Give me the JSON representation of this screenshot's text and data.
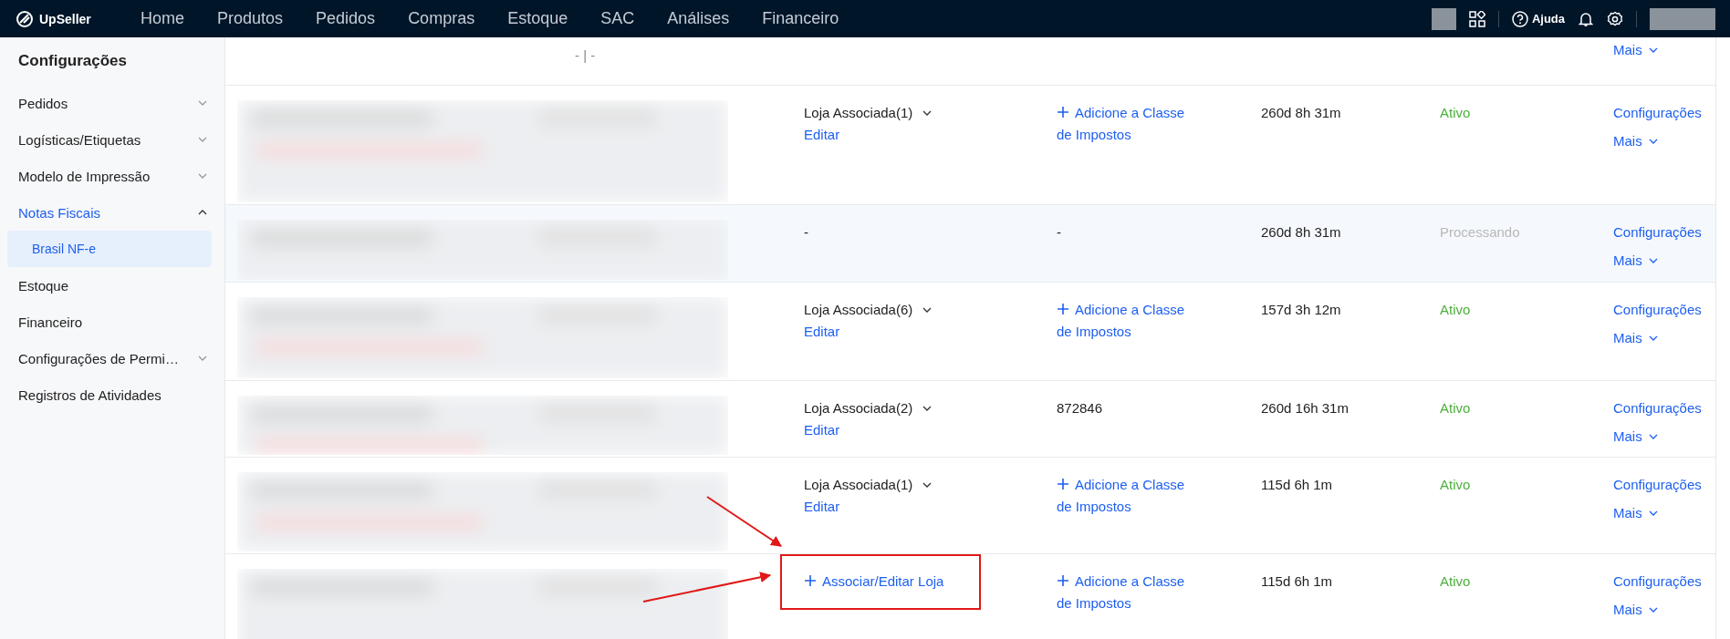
{
  "nav": {
    "brand": "UpSeller",
    "items": [
      {
        "label": "Home"
      },
      {
        "label": "Produtos"
      },
      {
        "label": "Pedidos"
      },
      {
        "label": "Compras"
      },
      {
        "label": "Estoque"
      },
      {
        "label": "SAC"
      },
      {
        "label": "Análises"
      },
      {
        "label": "Financeiro"
      }
    ],
    "help": "Ajuda"
  },
  "sidebar": {
    "title": "Configurações",
    "items": [
      {
        "label": "Pedidos",
        "expanded": false,
        "selected": false
      },
      {
        "label": "Logísticas/Etiquetas",
        "expanded": false,
        "selected": false
      },
      {
        "label": "Modelo de Impressão",
        "expanded": false,
        "selected": false
      },
      {
        "label": "Notas Fiscais",
        "expanded": true,
        "selected": true,
        "children": [
          {
            "label": "Brasil NF-e",
            "selected": true
          }
        ]
      },
      {
        "label": "Estoque",
        "selected": false
      },
      {
        "label": "Financeiro",
        "selected": false
      },
      {
        "label": "Configurações de Permi…",
        "expanded": false,
        "selected": false
      },
      {
        "label": "Registros de Atividades",
        "selected": false
      }
    ]
  },
  "table": {
    "rows": [
      {
        "blurred": false,
        "hovered": false,
        "code": "- | -",
        "actions": [
          {
            "label": "Mais",
            "kind": "menu"
          }
        ]
      },
      {
        "blurred": true,
        "hovered": false,
        "store": {
          "kind": "associated",
          "label": "Loja Associada(1)",
          "action": "Editar"
        },
        "tax": {
          "kind": "add",
          "text": "Adicione a Classe de Impostos"
        },
        "time": "260d 8h 31m",
        "status": {
          "text": "Ativo",
          "active": true
        },
        "actions": [
          {
            "label": "Configurações",
            "kind": "link"
          },
          {
            "label": "Mais",
            "kind": "menu"
          }
        ]
      },
      {
        "blurred": true,
        "hovered": true,
        "store": {
          "kind": "text",
          "label": "-"
        },
        "tax": {
          "kind": "text",
          "text": "-"
        },
        "time": "260d 8h 31m",
        "status": {
          "text": "Processando",
          "active": false
        },
        "actions": [
          {
            "label": "Configurações",
            "kind": "link"
          },
          {
            "label": "Mais",
            "kind": "menu"
          }
        ]
      },
      {
        "blurred": true,
        "hovered": false,
        "store": {
          "kind": "associated",
          "label": "Loja Associada(6)",
          "action": "Editar"
        },
        "tax": {
          "kind": "add",
          "text": "Adicione a Classe de Impostos"
        },
        "time": "157d 3h 12m",
        "status": {
          "text": "Ativo",
          "active": true
        },
        "actions": [
          {
            "label": "Configurações",
            "kind": "link"
          },
          {
            "label": "Mais",
            "kind": "menu"
          }
        ]
      },
      {
        "blurred": true,
        "hovered": false,
        "store": {
          "kind": "associated",
          "label": "Loja Associada(2)",
          "action": "Editar"
        },
        "tax": {
          "kind": "text",
          "text": "872846"
        },
        "time": "260d 16h 31m",
        "status": {
          "text": "Ativo",
          "active": true
        },
        "actions": [
          {
            "label": "Configurações",
            "kind": "link"
          },
          {
            "label": "Mais",
            "kind": "menu"
          }
        ]
      },
      {
        "blurred": true,
        "hovered": false,
        "store": {
          "kind": "associated",
          "label": "Loja Associada(1)",
          "action": "Editar"
        },
        "tax": {
          "kind": "add",
          "text": "Adicione a Classe de Impostos"
        },
        "time": "115d 6h 1m",
        "status": {
          "text": "Ativo",
          "active": true
        },
        "actions": [
          {
            "label": "Configurações",
            "kind": "link"
          },
          {
            "label": "Mais",
            "kind": "menu"
          }
        ]
      },
      {
        "blurred": true,
        "hovered": false,
        "store": {
          "kind": "add",
          "label": "Associar/Editar Loja",
          "annotated": true
        },
        "tax": {
          "kind": "add",
          "text": "Adicione a Classe de Impostos"
        },
        "time": "115d 6h 1m",
        "status": {
          "text": "Ativo",
          "active": true
        },
        "actions": [
          {
            "label": "Configurações",
            "kind": "link"
          },
          {
            "label": "Mais",
            "kind": "menu"
          }
        ]
      }
    ]
  }
}
